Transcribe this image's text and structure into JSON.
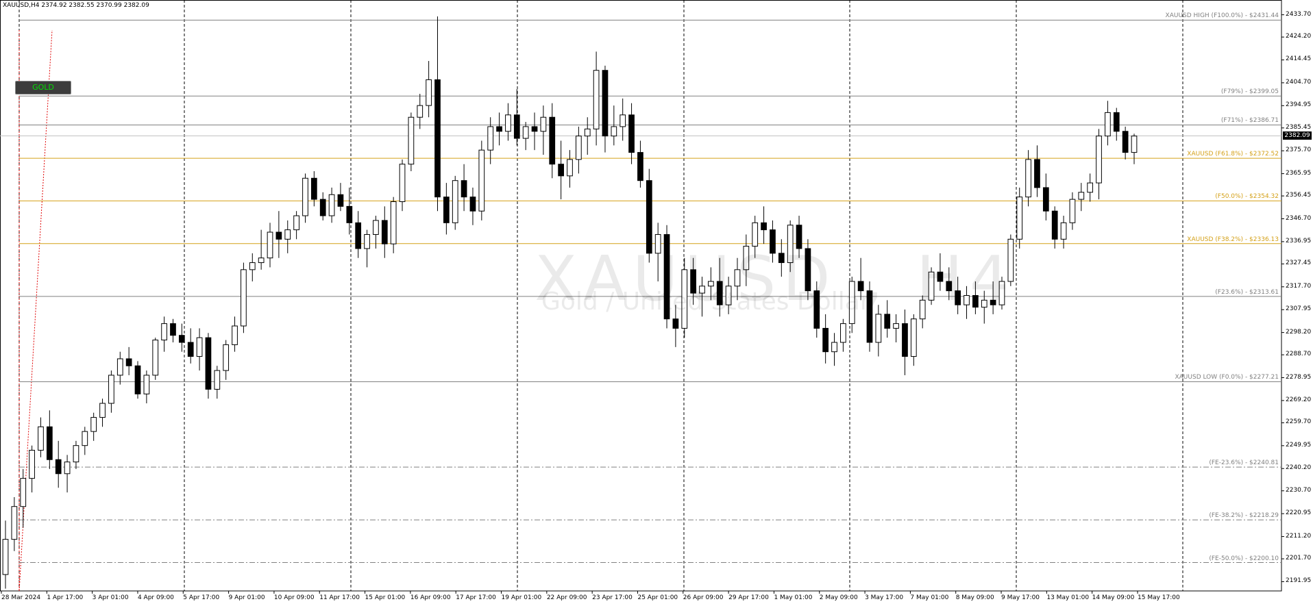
{
  "header": {
    "symbol_text": "XAUUSD,H4  2374.92 2382.55 2370.99 2382.09"
  },
  "button": {
    "label": "GOLD"
  },
  "watermark": {
    "symbol": "XAUUSD , H4",
    "description": "Gold / United States Dollar"
  },
  "current_price": "2382.09",
  "price_axis": [
    "2433.70",
    "2424.20",
    "2414.45",
    "2404.70",
    "2394.95",
    "2385.45",
    "2375.70",
    "2365.95",
    "2356.45",
    "2346.70",
    "2336.95",
    "2327.45",
    "2317.70",
    "2307.95",
    "2298.20",
    "2288.70",
    "2278.95",
    "2269.20",
    "2259.70",
    "2249.95",
    "2240.20",
    "2230.70",
    "2220.95",
    "2211.20",
    "2201.70",
    "2191.95"
  ],
  "levels": [
    {
      "text": "XAUUSD HIGH (F100.0%) - $2431.44",
      "price": 2431.44,
      "color": "#808080",
      "style": "solid"
    },
    {
      "text": "(F79%) - $2399.05",
      "price": 2399.05,
      "color": "#808080",
      "style": "solid"
    },
    {
      "text": "(F71%) - $2386.71",
      "price": 2386.71,
      "color": "#808080",
      "style": "solid"
    },
    {
      "text": "XAUUSD (F61.8%) - $2372.52",
      "price": 2372.52,
      "color": "#d4a017",
      "style": "solid"
    },
    {
      "text": "(F50.0%) - $2354.32",
      "price": 2354.32,
      "color": "#d4a017",
      "style": "solid"
    },
    {
      "text": "XAUUSD (F38.2%) - $2336.13",
      "price": 2336.13,
      "color": "#d4a017",
      "style": "solid"
    },
    {
      "text": "(F23.6%) - $2313.61",
      "price": 2313.61,
      "color": "#808080",
      "style": "solid"
    },
    {
      "text": "XAUUSD LOW (F0.0%) - $2277.21",
      "price": 2277.21,
      "color": "#808080",
      "style": "solid"
    },
    {
      "text": "(FE-23.6%) - $2240.81",
      "price": 2240.81,
      "color": "#808080",
      "style": "dashdot"
    },
    {
      "text": "(FE-38.2%) - $2218.29",
      "price": 2218.29,
      "color": "#808080",
      "style": "dashdot"
    },
    {
      "text": "(FE-50.0%) - $2200.10",
      "price": 2200.1,
      "color": "#808080",
      "style": "dashdot"
    }
  ],
  "time_axis": [
    "28 Mar 2024",
    "1 Apr 17:00",
    "3 Apr 01:00",
    "4 Apr 09:00",
    "5 Apr 17:00",
    "9 Apr 01:00",
    "10 Apr 09:00",
    "11 Apr 17:00",
    "15 Apr 01:00",
    "16 Apr 09:00",
    "17 Apr 17:00",
    "19 Apr 01:00",
    "22 Apr 09:00",
    "23 Apr 17:00",
    "25 Apr 01:00",
    "26 Apr 09:00",
    "29 Apr 17:00",
    "1 May 01:00",
    "2 May 09:00",
    "3 May 17:00",
    "7 May 01:00",
    "8 May 09:00",
    "9 May 17:00",
    "13 May 01:00",
    "14 May 09:00",
    "15 May 17:00"
  ],
  "chart_data": {
    "type": "candlestick",
    "symbol": "XAUUSD",
    "timeframe": "H4",
    "ylim": [
      2188,
      2440
    ],
    "candles": [
      [
        2195,
        2218,
        2189,
        2210
      ],
      [
        2210,
        2228,
        2205,
        2224
      ],
      [
        2224,
        2240,
        2215,
        2236
      ],
      [
        2236,
        2250,
        2230,
        2248
      ],
      [
        2248,
        2262,
        2245,
        2258
      ],
      [
        2258,
        2265,
        2240,
        2244
      ],
      [
        2244,
        2252,
        2232,
        2238
      ],
      [
        2238,
        2246,
        2230,
        2243
      ],
      [
        2243,
        2252,
        2240,
        2250
      ],
      [
        2250,
        2258,
        2246,
        2256
      ],
      [
        2256,
        2264,
        2252,
        2262
      ],
      [
        2262,
        2270,
        2258,
        2268
      ],
      [
        2268,
        2282,
        2264,
        2280
      ],
      [
        2280,
        2290,
        2276,
        2287
      ],
      [
        2287,
        2292,
        2280,
        2284
      ],
      [
        2284,
        2286,
        2270,
        2272
      ],
      [
        2272,
        2282,
        2268,
        2280
      ],
      [
        2280,
        2296,
        2278,
        2295
      ],
      [
        2295,
        2305,
        2290,
        2302
      ],
      [
        2302,
        2304,
        2294,
        2297
      ],
      [
        2297,
        2302,
        2290,
        2294
      ],
      [
        2294,
        2300,
        2285,
        2288
      ],
      [
        2288,
        2300,
        2282,
        2296
      ],
      [
        2296,
        2298,
        2270,
        2274
      ],
      [
        2274,
        2284,
        2270,
        2282
      ],
      [
        2282,
        2295,
        2278,
        2293
      ],
      [
        2293,
        2305,
        2290,
        2301
      ],
      [
        2301,
        2328,
        2298,
        2325
      ],
      [
        2325,
        2332,
        2320,
        2328
      ],
      [
        2328,
        2342,
        2325,
        2330
      ],
      [
        2330,
        2345,
        2326,
        2341
      ],
      [
        2341,
        2350,
        2330,
        2338
      ],
      [
        2338,
        2346,
        2332,
        2342
      ],
      [
        2342,
        2350,
        2338,
        2348
      ],
      [
        2348,
        2366,
        2345,
        2364
      ],
      [
        2364,
        2367,
        2352,
        2355
      ],
      [
        2355,
        2358,
        2346,
        2348
      ],
      [
        2348,
        2360,
        2345,
        2357
      ],
      [
        2357,
        2362,
        2350,
        2352
      ],
      [
        2352,
        2360,
        2340,
        2345
      ],
      [
        2345,
        2350,
        2330,
        2334
      ],
      [
        2334,
        2342,
        2326,
        2340
      ],
      [
        2340,
        2348,
        2334,
        2346
      ],
      [
        2346,
        2352,
        2330,
        2336
      ],
      [
        2336,
        2356,
        2332,
        2354
      ],
      [
        2354,
        2372,
        2350,
        2370
      ],
      [
        2370,
        2392,
        2367,
        2390
      ],
      [
        2390,
        2400,
        2385,
        2395
      ],
      [
        2395,
        2414,
        2390,
        2406
      ],
      [
        2406,
        2433,
        2350,
        2356
      ],
      [
        2356,
        2362,
        2340,
        2345
      ],
      [
        2345,
        2365,
        2342,
        2363
      ],
      [
        2363,
        2370,
        2350,
        2356
      ],
      [
        2356,
        2360,
        2344,
        2350
      ],
      [
        2350,
        2380,
        2346,
        2376
      ],
      [
        2376,
        2390,
        2370,
        2386
      ],
      [
        2386,
        2392,
        2378,
        2384
      ],
      [
        2384,
        2396,
        2380,
        2391
      ],
      [
        2391,
        2402,
        2378,
        2381
      ],
      [
        2381,
        2388,
        2376,
        2386
      ],
      [
        2386,
        2392,
        2376,
        2384
      ],
      [
        2384,
        2395,
        2374,
        2390
      ],
      [
        2390,
        2396,
        2364,
        2370
      ],
      [
        2370,
        2380,
        2355,
        2365
      ],
      [
        2365,
        2376,
        2360,
        2372
      ],
      [
        2372,
        2386,
        2366,
        2382
      ],
      [
        2382,
        2390,
        2374,
        2385
      ],
      [
        2385,
        2418,
        2378,
        2410
      ],
      [
        2410,
        2412,
        2375,
        2382
      ],
      [
        2382,
        2395,
        2378,
        2386
      ],
      [
        2386,
        2398,
        2380,
        2391
      ],
      [
        2391,
        2396,
        2370,
        2375
      ],
      [
        2375,
        2380,
        2360,
        2363
      ],
      [
        2363,
        2368,
        2328,
        2332
      ],
      [
        2332,
        2345,
        2320,
        2340
      ],
      [
        2340,
        2344,
        2300,
        2304
      ],
      [
        2304,
        2310,
        2292,
        2300
      ],
      [
        2300,
        2330,
        2296,
        2325
      ],
      [
        2325,
        2330,
        2310,
        2315
      ],
      [
        2315,
        2322,
        2305,
        2318
      ],
      [
        2318,
        2326,
        2312,
        2320
      ],
      [
        2320,
        2330,
        2305,
        2310
      ],
      [
        2310,
        2322,
        2306,
        2318
      ],
      [
        2318,
        2330,
        2312,
        2325
      ],
      [
        2325,
        2340,
        2318,
        2335
      ],
      [
        2335,
        2348,
        2330,
        2345
      ],
      [
        2345,
        2352,
        2336,
        2342
      ],
      [
        2342,
        2346,
        2328,
        2332
      ],
      [
        2332,
        2338,
        2322,
        2328
      ],
      [
        2328,
        2346,
        2324,
        2344
      ],
      [
        2344,
        2348,
        2330,
        2334
      ],
      [
        2334,
        2338,
        2312,
        2316
      ],
      [
        2316,
        2320,
        2296,
        2300
      ],
      [
        2300,
        2306,
        2285,
        2290
      ],
      [
        2290,
        2298,
        2284,
        2294
      ],
      [
        2294,
        2304,
        2290,
        2302
      ],
      [
        2302,
        2322,
        2298,
        2320
      ],
      [
        2320,
        2330,
        2312,
        2316
      ],
      [
        2316,
        2320,
        2290,
        2294
      ],
      [
        2294,
        2310,
        2288,
        2306
      ],
      [
        2306,
        2312,
        2296,
        2300
      ],
      [
        2300,
        2306,
        2294,
        2302
      ],
      [
        2302,
        2308,
        2280,
        2288
      ],
      [
        2288,
        2306,
        2284,
        2304
      ],
      [
        2304,
        2314,
        2300,
        2312
      ],
      [
        2312,
        2326,
        2310,
        2324
      ],
      [
        2324,
        2332,
        2316,
        2320
      ],
      [
        2320,
        2326,
        2312,
        2316
      ],
      [
        2316,
        2322,
        2306,
        2310
      ],
      [
        2310,
        2318,
        2304,
        2314
      ],
      [
        2314,
        2320,
        2306,
        2309
      ],
      [
        2309,
        2316,
        2302,
        2312
      ],
      [
        2312,
        2320,
        2306,
        2310
      ],
      [
        2310,
        2322,
        2308,
        2320
      ],
      [
        2320,
        2340,
        2318,
        2338
      ],
      [
        2338,
        2360,
        2334,
        2356
      ],
      [
        2356,
        2376,
        2352,
        2372
      ],
      [
        2372,
        2378,
        2356,
        2360
      ],
      [
        2360,
        2366,
        2346,
        2350
      ],
      [
        2350,
        2352,
        2334,
        2338
      ],
      [
        2338,
        2348,
        2334,
        2345
      ],
      [
        2345,
        2358,
        2342,
        2355
      ],
      [
        2355,
        2362,
        2350,
        2358
      ],
      [
        2358,
        2366,
        2354,
        2362
      ],
      [
        2362,
        2385,
        2355,
        2382
      ],
      [
        2382,
        2397,
        2378,
        2392
      ],
      [
        2392,
        2394,
        2380,
        2384
      ],
      [
        2384,
        2386,
        2372,
        2375
      ],
      [
        2375,
        2383,
        2370,
        2382
      ]
    ]
  }
}
